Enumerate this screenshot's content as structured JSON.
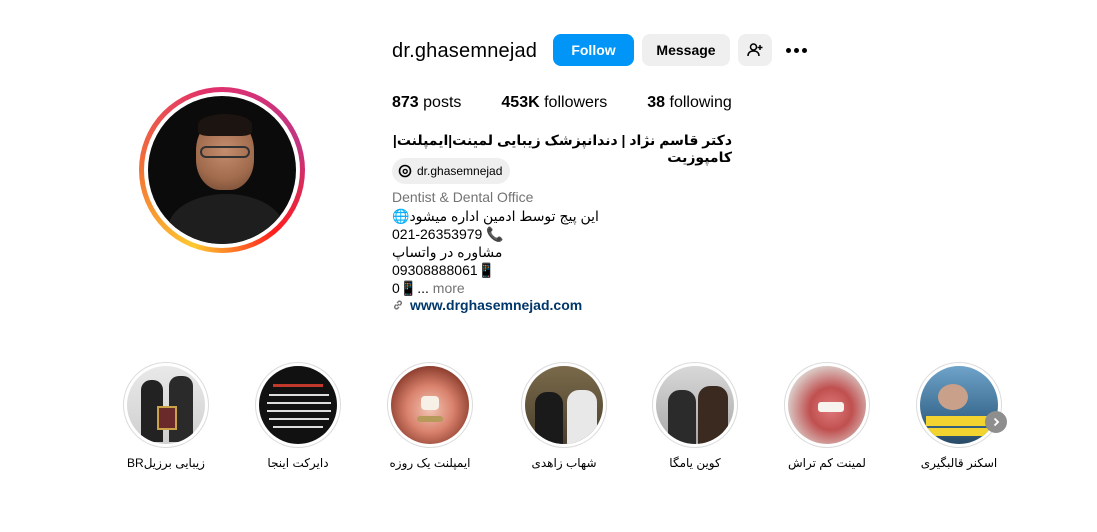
{
  "profile": {
    "username": "dr.ghasemnejad",
    "follow_label": "Follow",
    "message_label": "Message",
    "stats": {
      "posts_count": "873",
      "posts_label": "posts",
      "followers_count": "453K",
      "followers_label": "followers",
      "following_count": "38",
      "following_label": "following"
    },
    "full_name": "دکتر قاسم نژاد | دندانپزشک زیبایی لمینت|ایمپلنت|کامپوزیت",
    "threads_handle": "dr.ghasemnejad",
    "category": "Dentist & Dental Office",
    "bio_lines": [
      "🌐این پیج توسط ادمین اداره میشود",
      "021-26353979 📞",
      "مشاوره در واتساپ",
      "09308888061📱",
      "0📱..."
    ],
    "more_label": "more",
    "website": "www.drghasemnejad.com"
  },
  "highlights": [
    {
      "label": "زیبایی برزیلBR",
      "icon": "highlight-photo"
    },
    {
      "label": "دایرکت اینجا",
      "icon": "highlight-text"
    },
    {
      "label": "ایمپلنت یک روزه",
      "icon": "highlight-photo"
    },
    {
      "label": "شهاب زاهدی",
      "icon": "highlight-photo"
    },
    {
      "label": "کوین یامگا",
      "icon": "highlight-photo"
    },
    {
      "label": "لمینت کم تراش",
      "icon": "highlight-photo"
    },
    {
      "label": "اسکنر قالبگیری",
      "icon": "highlight-photo"
    }
  ],
  "colors": {
    "follow_button": "#0095f6",
    "secondary_button": "#efefef",
    "link": "#00376b",
    "muted_text": "#737373"
  }
}
